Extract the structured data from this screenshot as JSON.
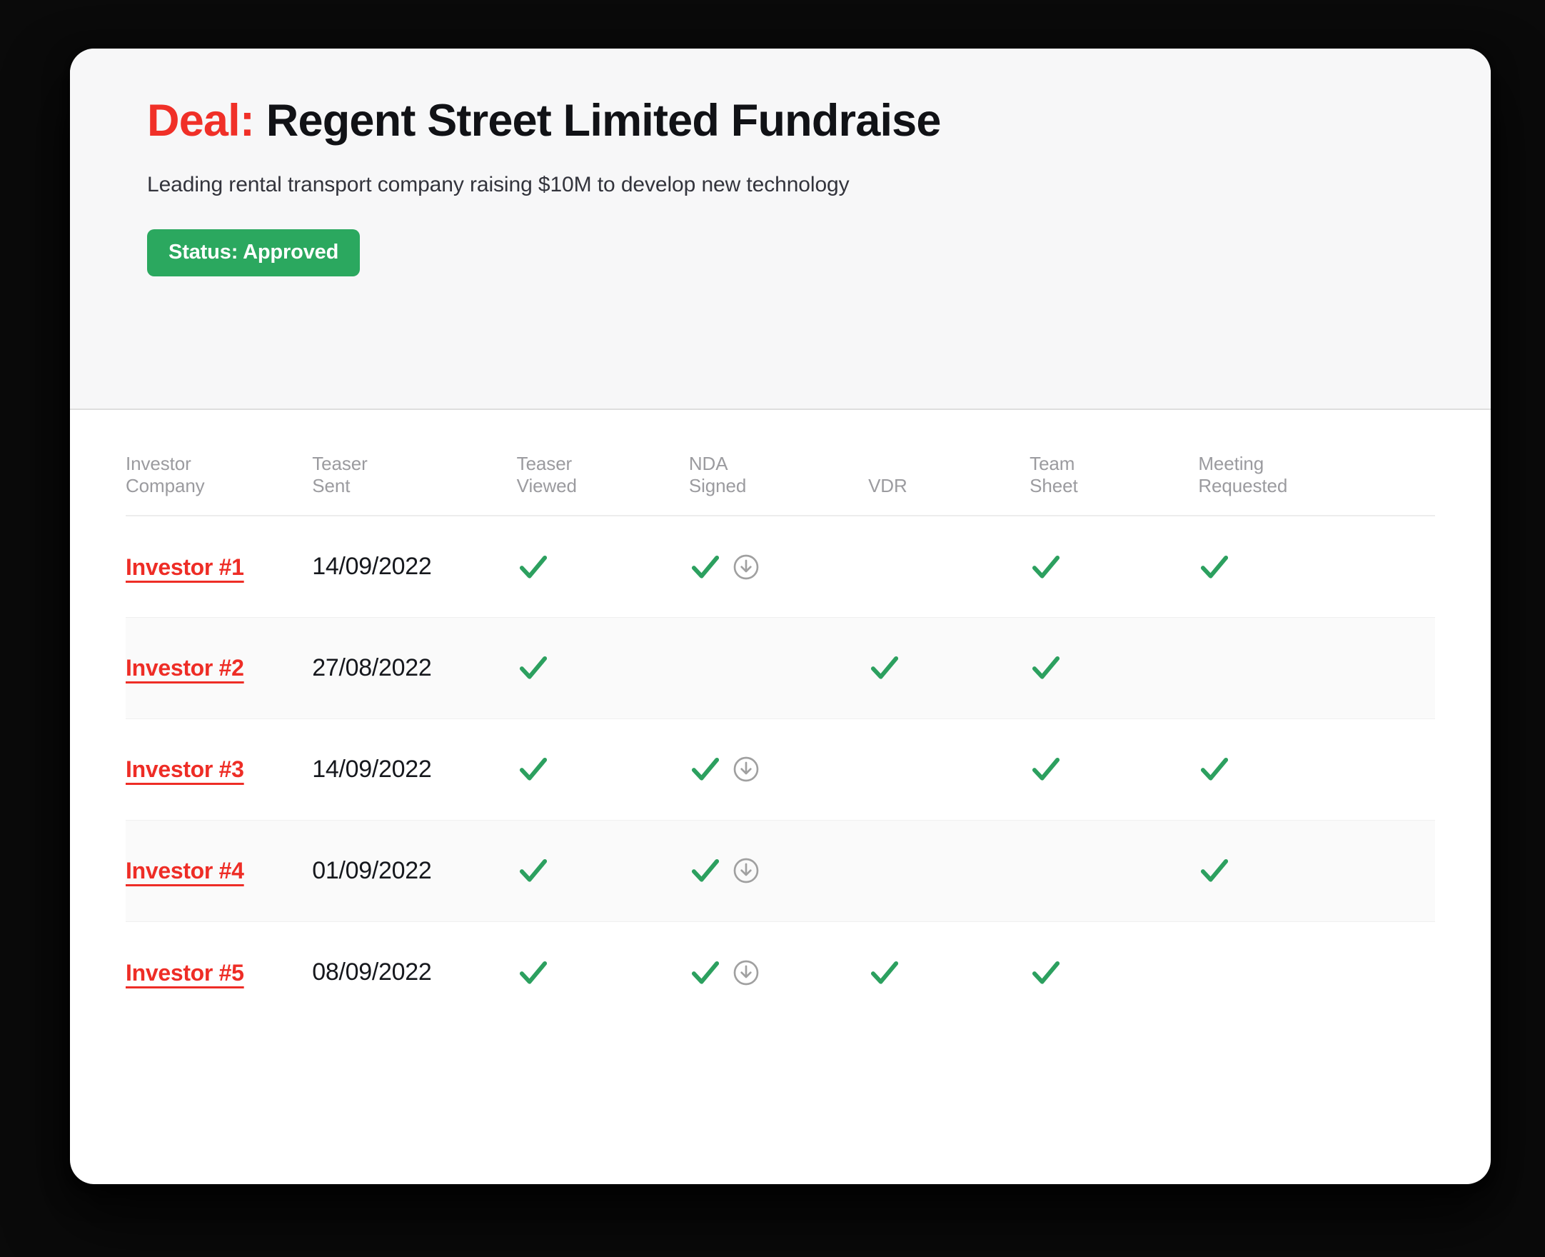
{
  "header": {
    "title_label": "Deal:",
    "title_name": "Regent Street Limited Fundraise",
    "subtitle": "Leading rental transport company raising $10M to develop new technology",
    "status_badge": "Status: Approved"
  },
  "colors": {
    "accent_red": "#ee2d26",
    "status_green": "#2BA85F",
    "check_green": "#2CA05F",
    "header_bg": "#f7f7f8",
    "icon_gray": "#a0a0a0"
  },
  "table": {
    "columns": [
      {
        "line1": "Investor",
        "line2": "Company",
        "key": "company"
      },
      {
        "line1": "Teaser",
        "line2": "Sent",
        "key": "teaser_sent"
      },
      {
        "line1": "Teaser",
        "line2": "Viewed",
        "key": "teaser_viewed"
      },
      {
        "line1": "NDA",
        "line2": "Signed",
        "key": "nda_signed"
      },
      {
        "line1": "",
        "line2": "VDR",
        "key": "vdr"
      },
      {
        "line1": "Team",
        "line2": "Sheet",
        "key": "team_sheet"
      },
      {
        "line1": "Meeting",
        "line2": "Requested",
        "key": "meeting_requested"
      }
    ],
    "rows": [
      {
        "company": "Investor #1",
        "teaser_sent": "14/09/2022",
        "teaser_viewed": true,
        "nda_signed": true,
        "nda_download": true,
        "vdr": false,
        "team_sheet": true,
        "meeting_requested": true
      },
      {
        "company": "Investor #2",
        "teaser_sent": "27/08/2022",
        "teaser_viewed": true,
        "nda_signed": false,
        "nda_download": false,
        "vdr": true,
        "team_sheet": true,
        "meeting_requested": false
      },
      {
        "company": "Investor #3",
        "teaser_sent": "14/09/2022",
        "teaser_viewed": true,
        "nda_signed": true,
        "nda_download": true,
        "vdr": false,
        "team_sheet": true,
        "meeting_requested": true
      },
      {
        "company": "Investor #4",
        "teaser_sent": "01/09/2022",
        "teaser_viewed": true,
        "nda_signed": true,
        "nda_download": true,
        "vdr": false,
        "team_sheet": false,
        "meeting_requested": true
      },
      {
        "company": "Investor #5",
        "teaser_sent": "08/09/2022",
        "teaser_viewed": true,
        "nda_signed": true,
        "nda_download": true,
        "vdr": true,
        "team_sheet": true,
        "meeting_requested": false
      }
    ]
  },
  "icons": {
    "check": "check-icon",
    "download": "download-icon"
  }
}
